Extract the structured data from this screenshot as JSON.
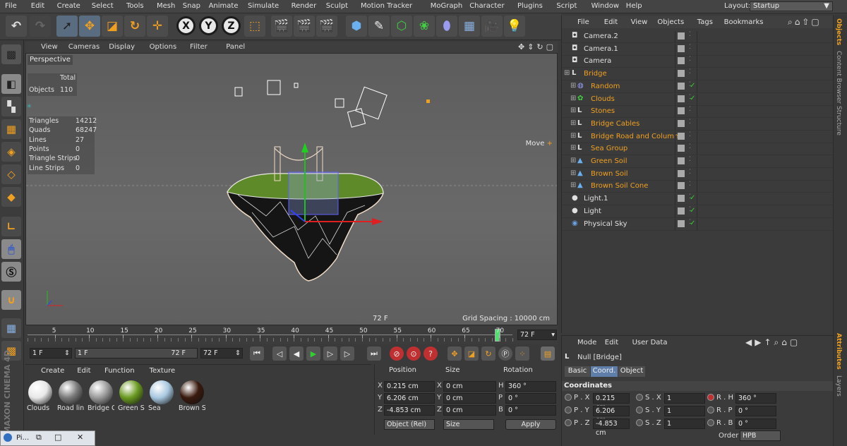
{
  "menu": [
    "File",
    "Edit",
    "Create",
    "Select",
    "Tools",
    "Mesh",
    "Snap",
    "Animate",
    "Simulate",
    "Render",
    "Sculpt",
    "Motion Tracker",
    "MoGraph",
    "Character",
    "Plugins",
    "Script",
    "Window",
    "Help"
  ],
  "layout": {
    "label": "Layout:",
    "value": "Startup"
  },
  "viewport": {
    "menu": [
      "View",
      "Cameras",
      "Display",
      "Options",
      "Filter",
      "Panel"
    ],
    "name": "Perspective",
    "move_label": "Move",
    "frame": "72 F",
    "grid_spacing": "Grid Spacing : 10000 cm",
    "stats": {
      "total_header": "Total",
      "objects_label": "Objects",
      "objects_value": "110",
      "rows": [
        {
          "label": "Triangles",
          "value": "14212"
        },
        {
          "label": "Quads",
          "value": "68247"
        },
        {
          "label": "Lines",
          "value": "27"
        },
        {
          "label": "Points",
          "value": "0"
        },
        {
          "label": "Triangle Strips",
          "value": "0"
        },
        {
          "label": "Line Strips",
          "value": "0"
        }
      ]
    }
  },
  "timeline": {
    "ticks": [
      "5",
      "10",
      "15",
      "20",
      "25",
      "30",
      "35",
      "40",
      "45",
      "50",
      "55",
      "60",
      "65",
      "70"
    ],
    "current": "72 F",
    "current_fraction": 0.97
  },
  "playback": {
    "start": "1 F",
    "range_start": "1 F",
    "range_end": "72 F",
    "end": "72 F"
  },
  "materials": {
    "menu": [
      "Create",
      "Edit",
      "Function",
      "Texture"
    ],
    "items": [
      {
        "name": "Clouds",
        "color": "#e8e8e8"
      },
      {
        "name": "Road lin",
        "color": "#7a7a7a"
      },
      {
        "name": "Bridge C",
        "color": "#9a9a9a"
      },
      {
        "name": "Green S",
        "color": "#6a9a20"
      },
      {
        "name": "Sea",
        "color": "#a8c8e0"
      },
      {
        "name": "Brown S",
        "color": "#3a1a0e"
      }
    ]
  },
  "coords": {
    "headers": [
      "Position",
      "Size",
      "Rotation"
    ],
    "rows": [
      {
        "axis": "X",
        "pos": "0.215 cm",
        "size_axis": "X",
        "size": "0 cm",
        "rot_axis": "H",
        "rot": "360 °"
      },
      {
        "axis": "Y",
        "pos": "6.206 cm",
        "size_axis": "Y",
        "size": "0 cm",
        "rot_axis": "P",
        "rot": "0 °"
      },
      {
        "axis": "Z",
        "pos": "-4.853 cm",
        "size_axis": "Z",
        "size": "0 cm",
        "rot_axis": "B",
        "rot": "0 °"
      }
    ],
    "mode_select": "Object (Rel)",
    "size_select": "Size",
    "apply": "Apply"
  },
  "objects": {
    "menu": [
      "File",
      "Edit",
      "View",
      "Objects",
      "Tags",
      "Bookmarks"
    ],
    "rows": [
      {
        "name": "Camera.2",
        "depth": 0,
        "color": "#e0e0e0"
      },
      {
        "name": "Camera.1",
        "depth": 0,
        "color": "#e0e0e0"
      },
      {
        "name": "Camera",
        "depth": 0,
        "color": "#e0e0e0"
      },
      {
        "name": "Bridge",
        "depth": 0,
        "color": "#f0a020"
      },
      {
        "name": "Random",
        "depth": 1,
        "color": "#f0a020"
      },
      {
        "name": "Clouds",
        "depth": 1,
        "color": "#f0a020"
      },
      {
        "name": "Stones",
        "depth": 1,
        "color": "#f0a020"
      },
      {
        "name": "Bridge Cables",
        "depth": 1,
        "color": "#f0a020"
      },
      {
        "name": "Bridge Road and Column",
        "depth": 1,
        "color": "#f0a020"
      },
      {
        "name": "Sea Group",
        "depth": 1,
        "color": "#f0a020"
      },
      {
        "name": "Green Soil",
        "depth": 1,
        "color": "#f0a020"
      },
      {
        "name": "Brown Soil",
        "depth": 1,
        "color": "#f0a020"
      },
      {
        "name": "Brown Soil Cone",
        "depth": 1,
        "color": "#f0a020"
      },
      {
        "name": "Light.1",
        "depth": 0,
        "color": "#e0e0e0"
      },
      {
        "name": "Light",
        "depth": 0,
        "color": "#e0e0e0"
      },
      {
        "name": "Physical Sky",
        "depth": 0,
        "color": "#e0e0e0"
      }
    ]
  },
  "attributes": {
    "menu": [
      "Mode",
      "Edit",
      "User Data"
    ],
    "object": "Null [Bridge]",
    "tabs": [
      "Basic",
      "Coord.",
      "Object"
    ],
    "section": "Coordinates",
    "rows": [
      {
        "p_label": "P . X",
        "p": "0.215 cm",
        "s_label": "S . X",
        "s": "1",
        "r_label": "R . H",
        "r": "360 °"
      },
      {
        "p_label": "P . Y",
        "p": "6.206 cm",
        "s_label": "S . Y",
        "s": "1",
        "r_label": "R . P",
        "r": "0 °"
      },
      {
        "p_label": "P . Z",
        "p": "-4.853 cm",
        "s_label": "S . Z",
        "s": "1",
        "r_label": "R . B",
        "r": "0 °"
      }
    ],
    "order_label": "Order",
    "order": "HPB"
  },
  "side_tabs": [
    "Objects",
    "Content Browser",
    "Structure",
    "Attributes",
    "Layers"
  ],
  "brand": "MAXON CINEMA 4D",
  "taskbar": {
    "label": "Pi..."
  }
}
